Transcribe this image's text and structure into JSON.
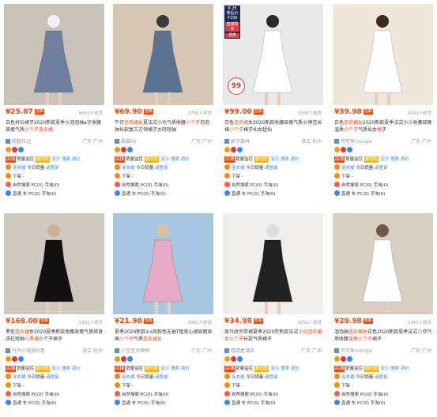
{
  "colors": {
    "price": "#ff4400",
    "tag_red": "#ff4400",
    "tag_yellow": "#ffb400",
    "link": "#3388ff"
  },
  "labels": {
    "baoyou": "包邮",
    "tag_shop": "店铺",
    "tool_sales_monitor": "销量监控",
    "tag_look": "看同款",
    "tool_links": "宝贝 搜索 调价",
    "shop_group": "连衣裙",
    "today_sales": "今日销量:",
    "please_login": "请登录",
    "downstream": "下架 -",
    "natural_search": "自然搜索 PC(0) 手淘(0)",
    "direct": "直通 车 PC(0) 手淘(0)"
  },
  "ad": {
    "date": "8.25",
    "line1": "券后价",
    "line2": "券后价",
    "price": "¥199",
    "btn1": "直接购买",
    "btn2": "领券",
    "stamp": "99"
  },
  "products": [
    {
      "price": "¥25.87",
      "sales": "4651人收货",
      "title_pre": "白色衬衫裙子2020新款夏季",
      "title_hl1": "女",
      "title_mid": "泡泡袖a字收腰显瘦气质",
      "title_hl2": "小个子连衣裙",
      "title_post": "",
      "shop": "甜趣日记",
      "loc": "广东 广州"
    },
    {
      "price": "¥69.90",
      "sales": "3700人收货",
      "title_pre": "牛仔",
      "title_hl1": "连衣裙女",
      "title_mid": "夏法式小众气质收腰",
      "title_hl2": "小个子",
      "title_post": "泡泡袖长款复古方领裙子大码短袖",
      "shop": "晨晨bb",
      "loc": "广东 广州"
    },
    {
      "price": "¥99.00",
      "sales": "3306人收货",
      "title_pre": "白色",
      "title_hl1": "连衣裙",
      "title_mid": "女2020新款收腰显瘦气质",
      "title_hl2": "女",
      "title_post": "神范长裙",
      "title_hl3": "小个子",
      "title_post2": "裙子仙女超仙",
      "shop": "妮子森林",
      "loc": "浙江 杭州"
    },
    {
      "price": "¥39.98",
      "sales": "2083人收货",
      "title_pre": "白色",
      "title_hl1": "连衣裙女",
      "title_mid": "2020新款夏季法式小",
      "title_hl2": "众",
      "title_post": "收腰显瘦温柔",
      "title_hl3": "小个子",
      "title_post2": "气质仙女",
      "title_hl4": "裙",
      "title_post3": "子",
      "shop": "可可家cocoga",
      "loc": "广东 广州"
    },
    {
      "price": "¥168.00",
      "sales": "1992人收货",
      "title_pre": "黑色",
      "title_hl1": "连衣裙",
      "title_mid": "女2020夏季新款收腰显瘦气质修身庆往短袖",
      "title_hl2": "小黑裙",
      "title_post": "小个子裙子",
      "shop": "丹丹小铺很好看",
      "loc": "浙江 杭州"
    },
    {
      "price": "¥21.98",
      "sales": "1881人收货",
      "title_pre": "夏季2020新款ins风粉色无袖T恤背心裙显瘦显高",
      "title_hl1": "小个子",
      "title_mid": "气质",
      "title_hl2": "连衣裙女",
      "title_post": "",
      "shop": "小宝宝大婶婶",
      "loc": "广东 广州"
    },
    {
      "price": "¥34.98",
      "sales": "1855人收货",
      "title_pre": "斑马纹吊带裙夏季2020年新款法式",
      "title_hl1": "小众连衣裙女",
      "title_mid": "",
      "title_hl2": "小个子",
      "title_post": "长款气质裙子",
      "shop": "嘻嘻屋潮店",
      "loc": "广东 广州"
    },
    {
      "price": "¥29.98",
      "sales": "1942人收货",
      "title_pre": "泡泡袖",
      "title_hl1": "连衣裙女",
      "title_mid": "白色2020新款夏季法式",
      "title_hl2": "小",
      "title_post": "众气质收腰",
      "title_hl3": "显瘦小个子",
      "title_post2": "裙子",
      "shop": "可可家cocoga",
      "loc": "广东 广州"
    }
  ]
}
